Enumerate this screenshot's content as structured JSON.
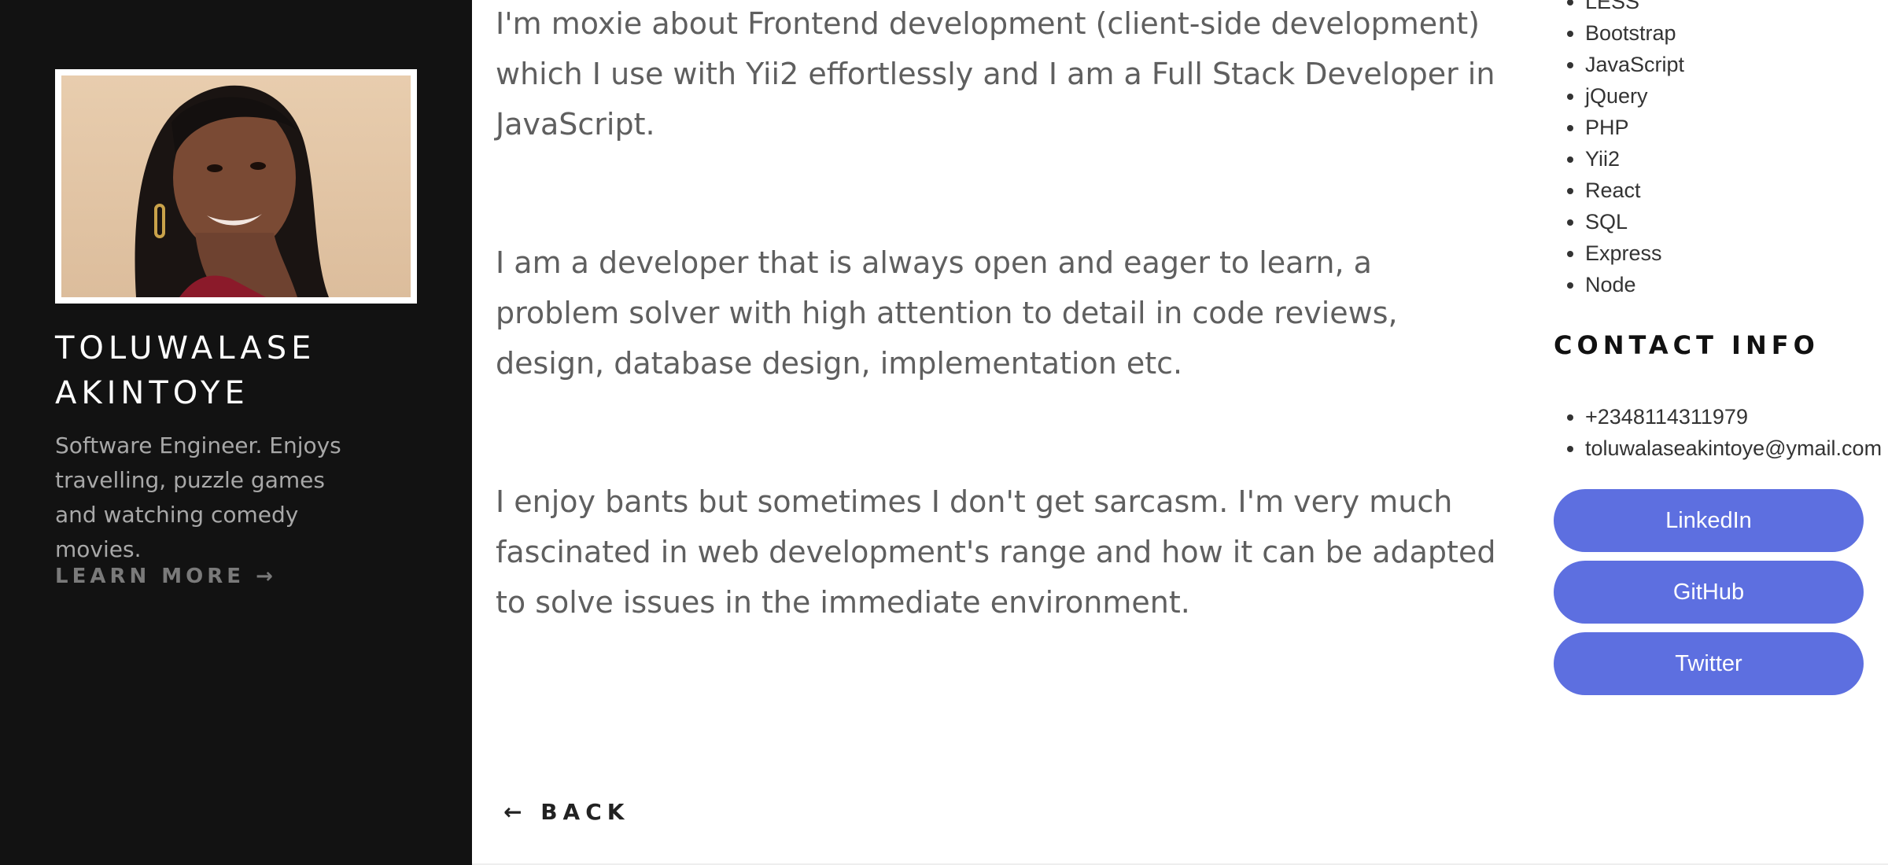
{
  "profile": {
    "name": "TOLUWALASE AKINTOYE",
    "bio": "Software Engineer. Enjoys travelling, puzzle games and watching comedy movies.",
    "learn_more": "LEARN MORE →"
  },
  "main": {
    "paragraphs": [
      "I'm moxie about Frontend development (client-side development) which I use with Yii2 effortlessly and I am a Full Stack Developer in JavaScript.",
      "I am a developer that is always open and eager to learn, a problem solver with high attention to detail in code reviews, design, database design, implementation etc.",
      "I enjoy bants but sometimes I don't get sarcasm. I'm very much fascinated in web development's range and how it can be adapted to solve issues in the immediate environment."
    ],
    "back": "← BACK"
  },
  "skills": [
    "LESS",
    "Bootstrap",
    "JavaScript",
    "jQuery",
    "PHP",
    "Yii2",
    "React",
    "SQL",
    "Express",
    "Node"
  ],
  "contact": {
    "heading": "CONTACT INFO",
    "items": [
      "+2348114311979",
      "toluwalaseakintoye@ymail.com"
    ]
  },
  "social": {
    "linkedin": "LinkedIn",
    "github": "GitHub",
    "twitter": "Twitter"
  },
  "colors": {
    "sidebar_bg": "#121212",
    "button_bg": "#5d6fe0",
    "body_text": "#5f5f5f"
  }
}
